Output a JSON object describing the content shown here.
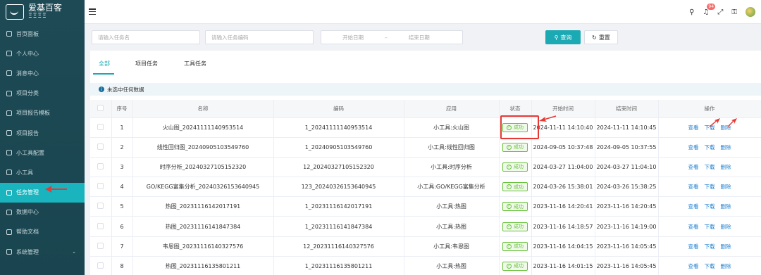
{
  "app": {
    "logo_text": "爱基百客",
    "logo_sub": "ΞΞΞΞ"
  },
  "sidebar": {
    "items": [
      {
        "label": "首页面板",
        "icon": "dashboard-icon"
      },
      {
        "label": "个人中心",
        "icon": "user-icon"
      },
      {
        "label": "消息中心",
        "icon": "message-icon"
      },
      {
        "label": "项目分类",
        "icon": "category-icon"
      },
      {
        "label": "项目报告模板",
        "icon": "template-icon"
      },
      {
        "label": "项目报告",
        "icon": "report-icon"
      },
      {
        "label": "小工具配置",
        "icon": "tool-config-icon"
      },
      {
        "label": "小工具",
        "icon": "tool-icon"
      },
      {
        "label": "任务管理",
        "icon": "task-icon",
        "active": true
      },
      {
        "label": "数据中心",
        "icon": "data-icon"
      },
      {
        "label": "帮助文档",
        "icon": "help-icon"
      },
      {
        "label": "系统管理",
        "icon": "settings-icon",
        "expandable": true
      }
    ]
  },
  "topbar": {
    "notification_count": "94"
  },
  "filters": {
    "task_name_placeholder": "请输入任务名",
    "task_code_placeholder": "请输入任务编码",
    "start_date_placeholder": "开始日期",
    "date_separator": "–",
    "end_date_placeholder": "结束日期",
    "search_label": "查询",
    "reset_label": "重置"
  },
  "tabs": [
    {
      "label": "全部",
      "active": true
    },
    {
      "label": "项目任务"
    },
    {
      "label": "工具任务"
    }
  ],
  "alert": {
    "text": "未选中任何数据"
  },
  "table": {
    "headers": [
      "",
      "序号",
      "名称",
      "编码",
      "应用",
      "状态",
      "开始时间",
      "结束时间",
      "操作"
    ],
    "rows": [
      {
        "no": "1",
        "name": "火山图_20241111140953514",
        "code": "1_20241111140953514",
        "app": "小工具:火山图",
        "status": "成功",
        "start": "2024-11-11 14:10:40",
        "end": "2024-11-11 14:10:45"
      },
      {
        "no": "2",
        "name": "线性回归图_20240905103549760",
        "code": "1_20240905103549760",
        "app": "小工具:线性回归图",
        "status": "成功",
        "start": "2024-09-05 10:37:48",
        "end": "2024-09-05 10:37:55"
      },
      {
        "no": "3",
        "name": "时序分析_20240327105152320",
        "code": "12_20240327105152320",
        "app": "小工具:时序分析",
        "status": "成功",
        "start": "2024-03-27 11:04:00",
        "end": "2024-03-27 11:04:10"
      },
      {
        "no": "4",
        "name": "GO/KEGG富集分析_20240326153640945",
        "code": "123_20240326153640945",
        "app": "小工具:GO/KEGG富集分析",
        "status": "成功",
        "start": "2024-03-26 15:38:01",
        "end": "2024-03-26 15:38:25"
      },
      {
        "no": "5",
        "name": "热图_20231116142017191",
        "code": "1_20231116142017191",
        "app": "小工具:热图",
        "status": "成功",
        "start": "2023-11-16 14:20:41",
        "end": "2023-11-16 14:20:45"
      },
      {
        "no": "6",
        "name": "热图_20231116141847384",
        "code": "1_20231116141847384",
        "app": "小工具:热图",
        "status": "成功",
        "start": "2023-11-16 14:18:57",
        "end": "2023-11-16 14:19:00"
      },
      {
        "no": "7",
        "name": "韦恩图_20231116140327576",
        "code": "12_20231116140327576",
        "app": "小工具:韦恩图",
        "status": "成功",
        "start": "2023-11-16 14:04:15",
        "end": "2023-11-16 14:05:45"
      },
      {
        "no": "8",
        "name": "热图_20231116135801211",
        "code": "1_20231116135801211",
        "app": "小工具:热图",
        "status": "成功",
        "start": "2023-11-16 14:01:15",
        "end": "2023-11-16 14:05:45"
      }
    ],
    "actions": {
      "view": "查看",
      "download": "下载",
      "delete": "删除"
    }
  },
  "colors": {
    "sidebar_bg": "#1d4a55",
    "accent": "#1ba9b4",
    "success": "#67c23a",
    "link": "#1e7fd0",
    "annotation": "#e53935"
  }
}
